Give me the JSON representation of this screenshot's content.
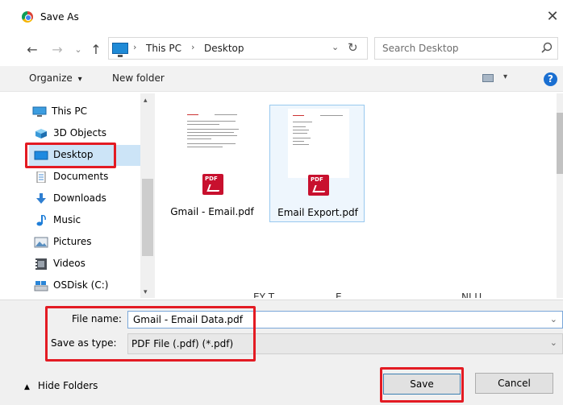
{
  "window": {
    "title": "Save As",
    "close_glyph": "✕"
  },
  "navigation": {
    "back_glyph": "←",
    "forward_glyph": "→",
    "recent_glyph": "⌄",
    "up_glyph": "↑",
    "breadcrumbs": [
      "This PC",
      "Desktop"
    ],
    "separator": "›",
    "dropdown_glyph": "⌄",
    "refresh_glyph": "↻"
  },
  "search": {
    "placeholder": "Search Desktop"
  },
  "toolbar": {
    "organize_label": "Organize",
    "organize_caret": "▾",
    "new_folder_label": "New folder",
    "view_caret": "▾",
    "help_label": "?"
  },
  "nav_pane": {
    "items": [
      {
        "label": "This PC",
        "icon": "computer-icon"
      },
      {
        "label": "3D Objects",
        "icon": "cube-icon"
      },
      {
        "label": "Desktop",
        "icon": "desktop-icon",
        "selected": true
      },
      {
        "label": "Documents",
        "icon": "documents-icon"
      },
      {
        "label": "Downloads",
        "icon": "download-icon"
      },
      {
        "label": "Music",
        "icon": "music-icon"
      },
      {
        "label": "Pictures",
        "icon": "pictures-icon"
      },
      {
        "label": "Videos",
        "icon": "videos-icon"
      },
      {
        "label": "OSDisk (C:)",
        "icon": "drive-icon"
      }
    ],
    "scroll_up": "▴",
    "scroll_down": "▾"
  },
  "files": [
    {
      "name": "Gmail - Email.pdf",
      "icon": "pdf-icon"
    },
    {
      "name": "Email Export.pdf",
      "icon": "pdf-icon",
      "highlighted": true
    }
  ],
  "cut_off_labels": [
    "EY T",
    "E",
    "NI U"
  ],
  "form": {
    "file_name_label": "File name:",
    "file_name_value": "Gmail - Email Data.pdf",
    "save_type_label": "Save as type:",
    "save_type_value": "PDF File (.pdf) (*.pdf)",
    "dropdown_glyph": "⌄"
  },
  "footer": {
    "hide_folders_glyph": "▲",
    "hide_folders_label": "Hide Folders",
    "save_label": "Save",
    "cancel_label": "Cancel"
  },
  "colors": {
    "highlight_box": "#e31b23",
    "selection": "#cce4f7",
    "accent": "#1a6fd1"
  }
}
